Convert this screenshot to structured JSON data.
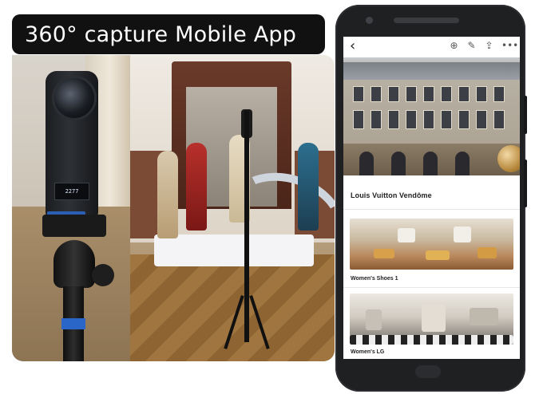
{
  "banner": {
    "title": "360° capture Mobile App"
  },
  "camera": {
    "screen_text": "2277"
  },
  "app": {
    "store_title": "Louis Vuitton Vendôme",
    "cards": [
      {
        "label": "Women's Shoes 1"
      },
      {
        "label": "Women's LG"
      }
    ]
  },
  "icons": {
    "back": "chevron-left-icon",
    "add": "plus-circle-icon",
    "edit": "pencil-icon",
    "share": "share-icon",
    "more": "more-icon"
  },
  "colors": {
    "banner_bg": "#111111",
    "banner_text": "#ffffff",
    "phone_body": "#1f2022",
    "accent_blue": "#2b5fb3"
  }
}
